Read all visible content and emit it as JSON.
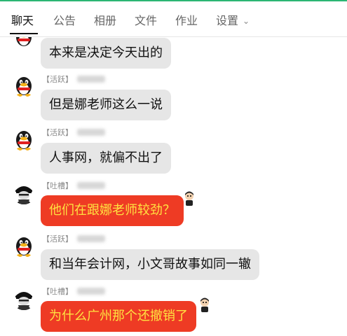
{
  "tabs": [
    {
      "label": "聊天",
      "active": true
    },
    {
      "label": "公告",
      "active": false
    },
    {
      "label": "相册",
      "active": false
    },
    {
      "label": "文件",
      "active": false
    },
    {
      "label": "作业",
      "active": false
    },
    {
      "label": "设置",
      "active": false
    }
  ],
  "settings_chevron": "chevron-down-icon",
  "messages": [
    {
      "text": "本来是决定今天出的",
      "style": "gray"
    },
    {
      "tag": "【活跃】",
      "text": "但是娜老师这么一说",
      "style": "gray",
      "avatar": "penguin-avatar-icon"
    },
    {
      "tag": "【活跃】",
      "text": "人事网，就偏不出了",
      "style": "gray",
      "avatar": "penguin-avatar-icon"
    },
    {
      "tag": "【吐槽】",
      "text": "他们在跟娜老师较劲？",
      "style": "red",
      "avatar": "dark-avatar-icon"
    },
    {
      "tag": "【活跃】",
      "text": "和当年会计网，小文哥故事如同一辙",
      "style": "gray",
      "avatar": "penguin-avatar-icon"
    },
    {
      "tag": "【吐槽】",
      "text": "为什么广州那个还撤销了",
      "style": "red",
      "avatar": "dark-avatar-icon"
    }
  ],
  "colors": {
    "accent": "#2bb673",
    "bubble_gray": "#e6e6e6",
    "bubble_red": "#ee3b24",
    "bubble_red_text": "#ffe240"
  }
}
